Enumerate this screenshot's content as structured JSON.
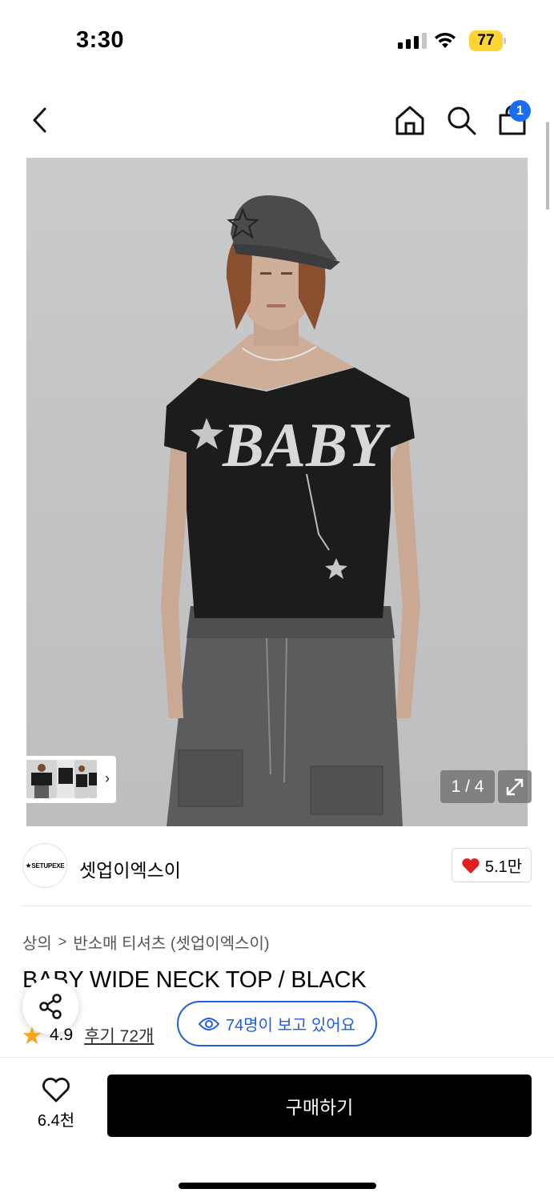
{
  "status_bar": {
    "time": "3:30",
    "battery": "77",
    "battery_color": "#fcd535"
  },
  "nav": {
    "icons": [
      "back-chevron-icon",
      "home-icon",
      "search-icon",
      "cart-icon"
    ],
    "cart_badge": "1",
    "badge_color": "#1a6ef5"
  },
  "gallery": {
    "counter": "1 / 4",
    "thumbnail_count": 4,
    "expand_icon": "expand-arrows-icon"
  },
  "brand": {
    "logo_text": "SETUPEXE",
    "name": "셋업이엑스이",
    "likes": "5.1만",
    "heart_color": "#e02020"
  },
  "breadcrumb": {
    "items": [
      "상의",
      "반소매 티셔츠 (셋업이엑스이)"
    ],
    "separator": ">"
  },
  "product": {
    "title": "BABY WIDE NECK TOP / BLACK",
    "rating": "4.9",
    "reviews": "후기 72개",
    "viewers": "74명이 보고 있어요",
    "accent_color": "#1f5ee0"
  },
  "actions": {
    "wishlist_count": "6.4천",
    "buy_label": "구매하기"
  }
}
